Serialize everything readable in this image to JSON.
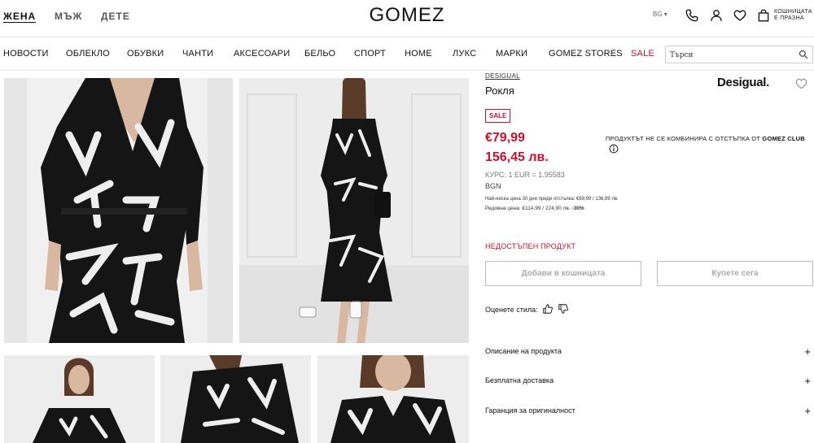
{
  "header": {
    "genders": [
      "ЖЕНА",
      "МЪЖ",
      "ДЕТЕ"
    ],
    "logo": "GOMEZ",
    "language": "BG ▾",
    "cart_line1": "КОШНИЦАТА",
    "cart_line2": "Е ПРАЗНА",
    "icons": [
      "phone-icon",
      "user-icon",
      "heart-icon",
      "bag-icon"
    ]
  },
  "nav": {
    "items": [
      "НОВОСТИ",
      "ОБЛЕКЛО",
      "ОБУВКИ",
      "ЧАНТИ",
      "АКСЕСОАРИ",
      "БЕЛЬО",
      "СПОРТ",
      "HOME",
      "ЛУКС",
      "МАРКИ",
      "GOMEZ STORES"
    ],
    "sale": "SALE",
    "search_placeholder": "Търси"
  },
  "product": {
    "brand": "DESIGUAL",
    "title": "Рокля",
    "brand_logo": "Desigual.",
    "badge": "SALE",
    "price_eur": "€79,99",
    "price_bgn": "156,45 лв.",
    "rate": "КУРС: 1 EUR = 1.95583",
    "currency": "BGN",
    "lowest_price": "Най-ниска цена 30 дни преди отстъпка: €69,99 / 136,89 лв.",
    "regular_price": "Редовна цена: €114,99 / 224,90 лв.",
    "discount": "-30%",
    "club_note_prefix": "ПРОДУКТЪТ НЕ СЕ КОМБИНИРА С ОТСТЪПКА ОТ",
    "club_note_bold": "GOMEZ CLUB",
    "unavailable": "НЕДОСТЪПЕН ПРОДУКТ",
    "add_to_cart": "Добави в кошницата",
    "buy_now": "Купете сега",
    "rate_style": "Оценете стила:",
    "accordion": [
      "Описание на продукта",
      "Безплатна доставка",
      "Гаранция за оригиналност"
    ]
  },
  "colors": {
    "accent_red": "#c8102e",
    "dress_black": "#151515",
    "print_white": "#eeeeee"
  }
}
